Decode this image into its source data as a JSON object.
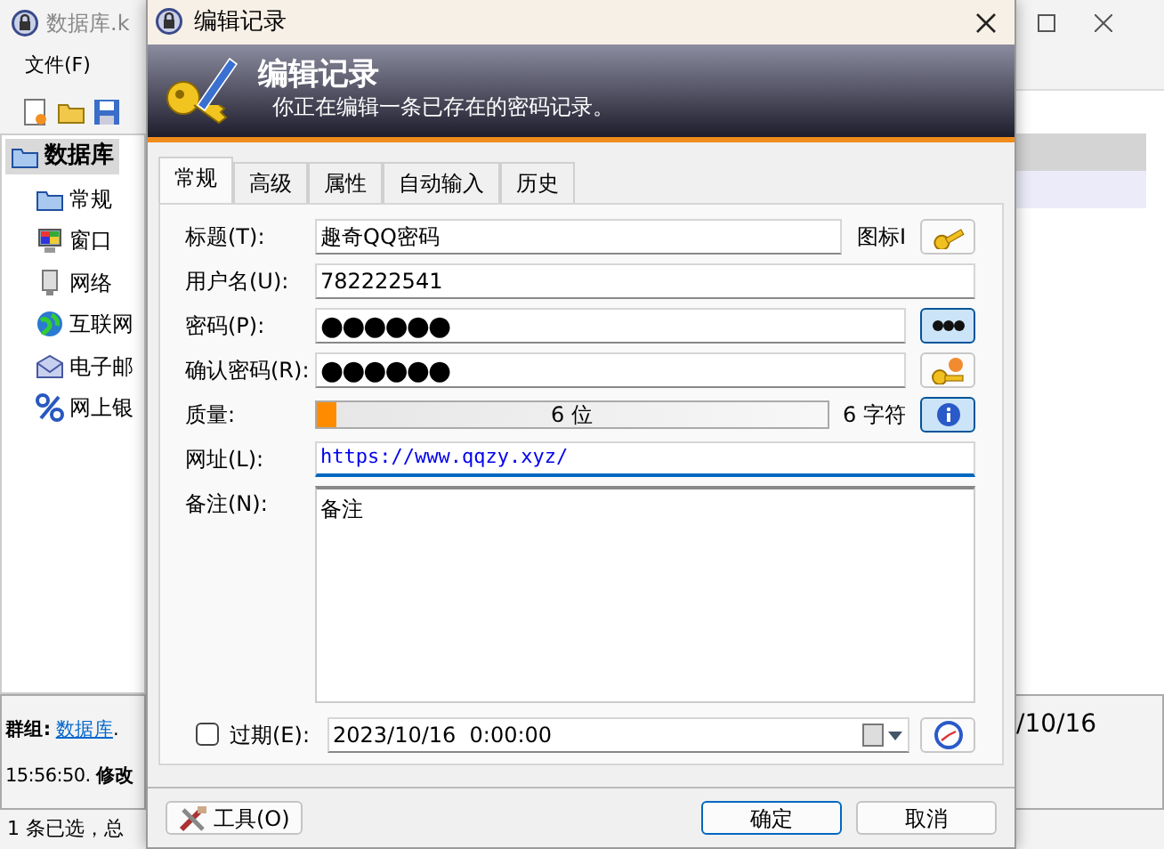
{
  "background_window": {
    "title": "数据库.k",
    "menu": [
      "文件(F)"
    ],
    "tree": [
      {
        "label": "数据库",
        "selected": true,
        "children": [
          {
            "label": "常规",
            "selected": false
          },
          {
            "label": "窗口",
            "selected": false
          },
          {
            "label": "网络",
            "selected": false
          },
          {
            "label": "互联网",
            "selected": false
          },
          {
            "label": "电子邮",
            "selected": false
          },
          {
            "label": "网上银",
            "selected": false
          }
        ]
      }
    ],
    "entry_rows": [
      {
        "selected": true
      },
      {
        "selected": false
      }
    ],
    "details": {
      "group_label": "群组:",
      "group_link": "数据库",
      "group_rest": ".",
      "date_fragment": "/10/16",
      "line_2": "15:56:50. **修改**"
    },
    "status_bar": "1 条已选，总"
  },
  "dialog": {
    "title": "编辑记录",
    "banner_title": "编辑记录",
    "banner_subtitle": "你正在编辑一条已存在的密码记录。",
    "tabs": [
      {
        "label": "常规",
        "selected": true
      },
      {
        "label": "高级",
        "selected": false
      },
      {
        "label": "属性",
        "selected": false
      },
      {
        "label": "自动输入",
        "selected": false
      },
      {
        "label": "历史",
        "selected": false
      }
    ],
    "fields": [
      {
        "kind": "title",
        "label": "标题(T):",
        "value": "趣奇QQ密码",
        "side_label": "图标I"
      },
      {
        "kind": "text",
        "label": "用户名(U):",
        "value": "782222541"
      },
      {
        "kind": "password",
        "label": "密码(P):",
        "value": "●●●●●●",
        "pressed": true
      },
      {
        "kind": "password",
        "label": "确认密码(R):",
        "value": "●●●●●●",
        "pressed": false
      },
      {
        "kind": "quality",
        "label": "质量:",
        "level": 0.04,
        "bar_text": "6 位",
        "reading": "6 字符"
      },
      {
        "kind": "url",
        "label": "网址(L):",
        "value": "https://www.qqzy.xyz/"
      },
      {
        "kind": "notes",
        "label": "备注(N):",
        "value": "备注"
      }
    ],
    "expires": {
      "label": "过期(E):",
      "checked": false,
      "value": "2023/10/16  0:00:00"
    },
    "tools_button": "工具(O)",
    "ok_button": "确定",
    "cancel_button": "取消"
  }
}
